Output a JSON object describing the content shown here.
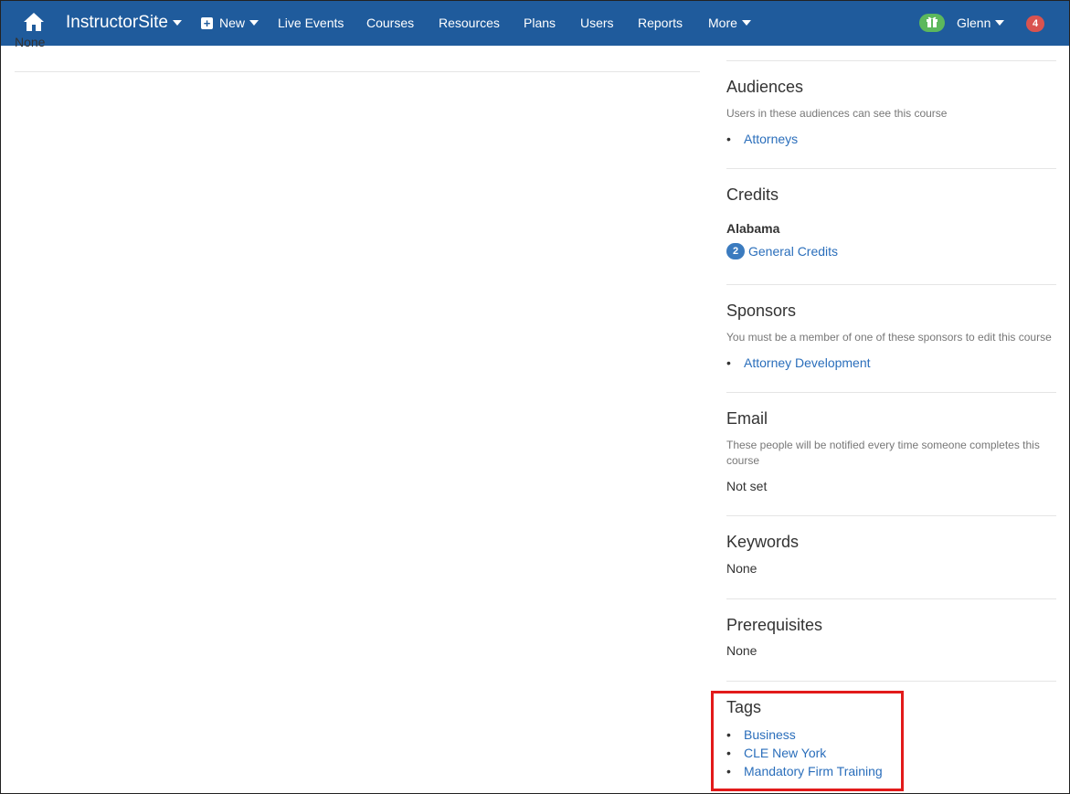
{
  "navbar": {
    "brand": "InstructorSite",
    "new_label": "New",
    "items": [
      "Live Events",
      "Courses",
      "Resources",
      "Plans",
      "Users",
      "Reports"
    ],
    "more_label": "More",
    "user_name": "Glenn",
    "notification_count": "4"
  },
  "left": {
    "none_text": "None"
  },
  "sections": {
    "audiences": {
      "title": "Audiences",
      "help": "Users in these audiences can see this course",
      "items": [
        "Attorneys"
      ]
    },
    "credits": {
      "title": "Credits",
      "state": "Alabama",
      "count": "2",
      "credit_label": "General Credits"
    },
    "sponsors": {
      "title": "Sponsors",
      "help": "You must be a member of one of these sponsors to edit this course",
      "items": [
        "Attorney Development"
      ]
    },
    "email": {
      "title": "Email",
      "help": "These people will be notified every time someone completes this course",
      "value": "Not set"
    },
    "keywords": {
      "title": "Keywords",
      "value": "None"
    },
    "prerequisites": {
      "title": "Prerequisites",
      "value": "None"
    },
    "tags": {
      "title": "Tags",
      "items": [
        "Business",
        "CLE New York",
        "Mandatory Firm Training"
      ]
    }
  },
  "colors": {
    "navbar": "#1f5b9c",
    "link": "#2a6ebb",
    "highlight": "#e21a1a",
    "gift": "#5cb85c",
    "notification": "#d9534f"
  }
}
